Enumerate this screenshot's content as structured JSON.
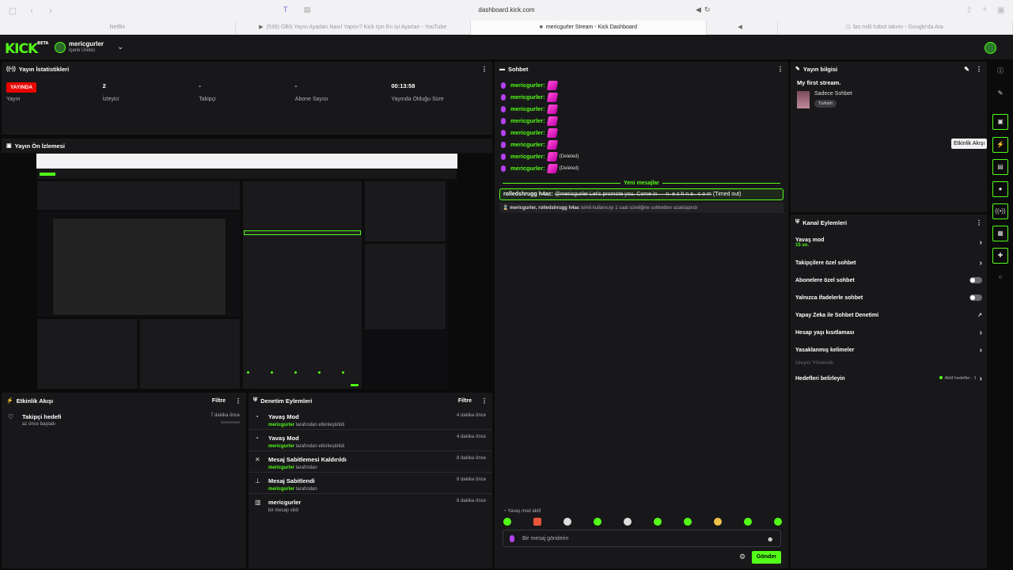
{
  "browser": {
    "url": "dashboard.kick.com",
    "tabs": [
      "Netflix",
      "(539) OBS Yayın Ayarları Nasıl Yapılır? Kick İçin En İyi Ayarları - YouTube",
      "mericgurler Stream - Kick Dashboard",
      "",
      "fas milli futbol takımı - Google'da Ara"
    ]
  },
  "header": {
    "logo": "KICK",
    "logo_badge": "BETA",
    "user_name": "mericgurler",
    "user_role": "İçerik Üretici"
  },
  "stats": {
    "title": "Yayın İstatistikleri",
    "items": [
      {
        "value": "YAYINDA",
        "label": "Yayın"
      },
      {
        "value": "2",
        "label": "İzleyici"
      },
      {
        "value": "-",
        "label": "Takipçi"
      },
      {
        "value": "-",
        "label": "Abone Sayısı"
      },
      {
        "value": "00:13:58",
        "label": "Yayında Olduğu Süre"
      }
    ]
  },
  "preview": {
    "title": "Yayın Ön İzlemesi"
  },
  "activity": {
    "title": "Etkinlik Akışı",
    "filter": "Filtre",
    "items": [
      {
        "title": "Takipçi hedefi",
        "sub": "az önce başladı",
        "time": "7 dakika önce"
      }
    ]
  },
  "moderation": {
    "title": "Denetim Eylemleri",
    "filter": "Filtre",
    "items": [
      {
        "title": "Yavaş Mod",
        "user": "mericgurler",
        "sub": "tarafından etkinleştirildi",
        "time": "4 dakika önce"
      },
      {
        "title": "Yavaş Mod",
        "user": "mericgurler",
        "sub": "tarafından etkinleştirildi",
        "time": "4 dakika önce"
      },
      {
        "title": "Mesaj Sabitlemesi Kaldırıldı",
        "user": "mericgurler",
        "sub": "tarafından",
        "time": "8 dakika önce"
      },
      {
        "title": "Mesaj Sabitlendi",
        "user": "mericgurler",
        "sub": "tarafından",
        "time": "8 dakika önce"
      },
      {
        "title": "mericgurler",
        "user": "",
        "sub": "bir mesajı sildi",
        "time": "8 dakika önce"
      }
    ]
  },
  "chat": {
    "title": "Sohbet",
    "messages": [
      {
        "user": "mericgurler:",
        "note": ""
      },
      {
        "user": "mericgurler:",
        "note": ""
      },
      {
        "user": "mericgurler:",
        "note": ""
      },
      {
        "user": "mericgurler:",
        "note": ""
      },
      {
        "user": "mericgurler:",
        "note": ""
      },
      {
        "user": "mericgurler:",
        "note": ""
      },
      {
        "user": "mericgurler:",
        "note": "(Deleted)"
      },
      {
        "user": "mericgurler:",
        "note": "(Deleted)"
      }
    ],
    "new_messages": "Yeni mesajlar",
    "timeout_user": "rolledshrugg h4ac:",
    "timeout_text": "@mericgurler Let's promote you. Come in — n. e z h n a . c o m",
    "timeout_tag": "(Timed out)",
    "system_users": "mericgurler, rolledshrugg h4ac",
    "system_text": "isimli kullanıcıyı 1 saat süreliğine sohbetten uzaklaştırdı",
    "slow_mode": "Yavaş mod aktif",
    "placeholder": "Bir mesaj gönderin",
    "send": "Gönder"
  },
  "info": {
    "title": "Yayın bilgisi",
    "stream_title": "My first stream.",
    "category": "Sadece Sohbet",
    "tag": "Turkish"
  },
  "channel": {
    "title": "Kanal Eylemleri",
    "slow_label": "Yavaş mod",
    "slow_value": "15 sn.",
    "followers": "Takipçilere özel sohbet",
    "subs": "Abonelere özel sohbet",
    "emotes": "Yalnızca ifadelerle sohbet",
    "ai": "Yapay Zeka ile Sohbet Denetimi",
    "age": "Hesap yaşı kısıtlaması",
    "banned": "Yasaklanmış kelimeler",
    "section": "İzleyici Yönlendir",
    "goals": "Hedefleri belirleyin",
    "goals_status": "Aktif hedefler - 1"
  },
  "sidebar": {
    "tooltip": "Etkinlik Akışı"
  },
  "colors": {
    "accent": "#53fc18",
    "live": "#eb0400",
    "panel": "#18181a"
  }
}
